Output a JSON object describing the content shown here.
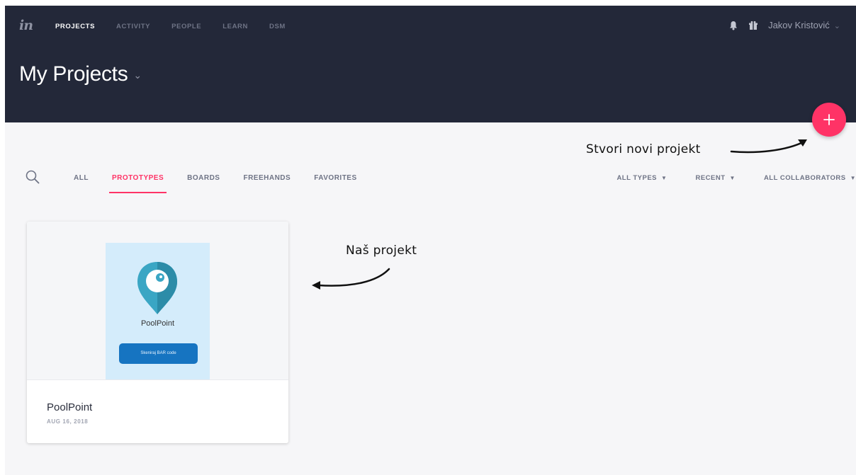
{
  "header": {
    "logo": "in",
    "nav": [
      {
        "label": "PROJECTS",
        "active": true
      },
      {
        "label": "ACTIVITY",
        "active": false
      },
      {
        "label": "PEOPLE",
        "active": false
      },
      {
        "label": "LEARN",
        "active": false
      },
      {
        "label": "DSM",
        "active": false
      }
    ],
    "user_name": "Jakov Kristović",
    "page_title": "My Projects"
  },
  "fab_icon": "plus-icon",
  "annotations": {
    "new_project": "Stvori novi projekt",
    "our_project": "Naš projekt"
  },
  "filters": {
    "tabs": [
      {
        "label": "ALL",
        "active": false
      },
      {
        "label": "PROTOTYPES",
        "active": true
      },
      {
        "label": "BOARDS",
        "active": false
      },
      {
        "label": "FREEHANDS",
        "active": false
      },
      {
        "label": "FAVORITES",
        "active": false
      }
    ],
    "dropdowns": [
      "ALL TYPES",
      "RECENT",
      "ALL COLLABORATORS"
    ]
  },
  "projects": [
    {
      "title": "PoolPoint",
      "date": "AUG 16, 2018",
      "thumbnail": {
        "app_name": "PoolPoint",
        "button_label": "Skeniraj BAR code"
      }
    }
  ],
  "colors": {
    "header_bg": "#232839",
    "accent": "#ff3366",
    "page_bg": "#f6f6f8"
  }
}
